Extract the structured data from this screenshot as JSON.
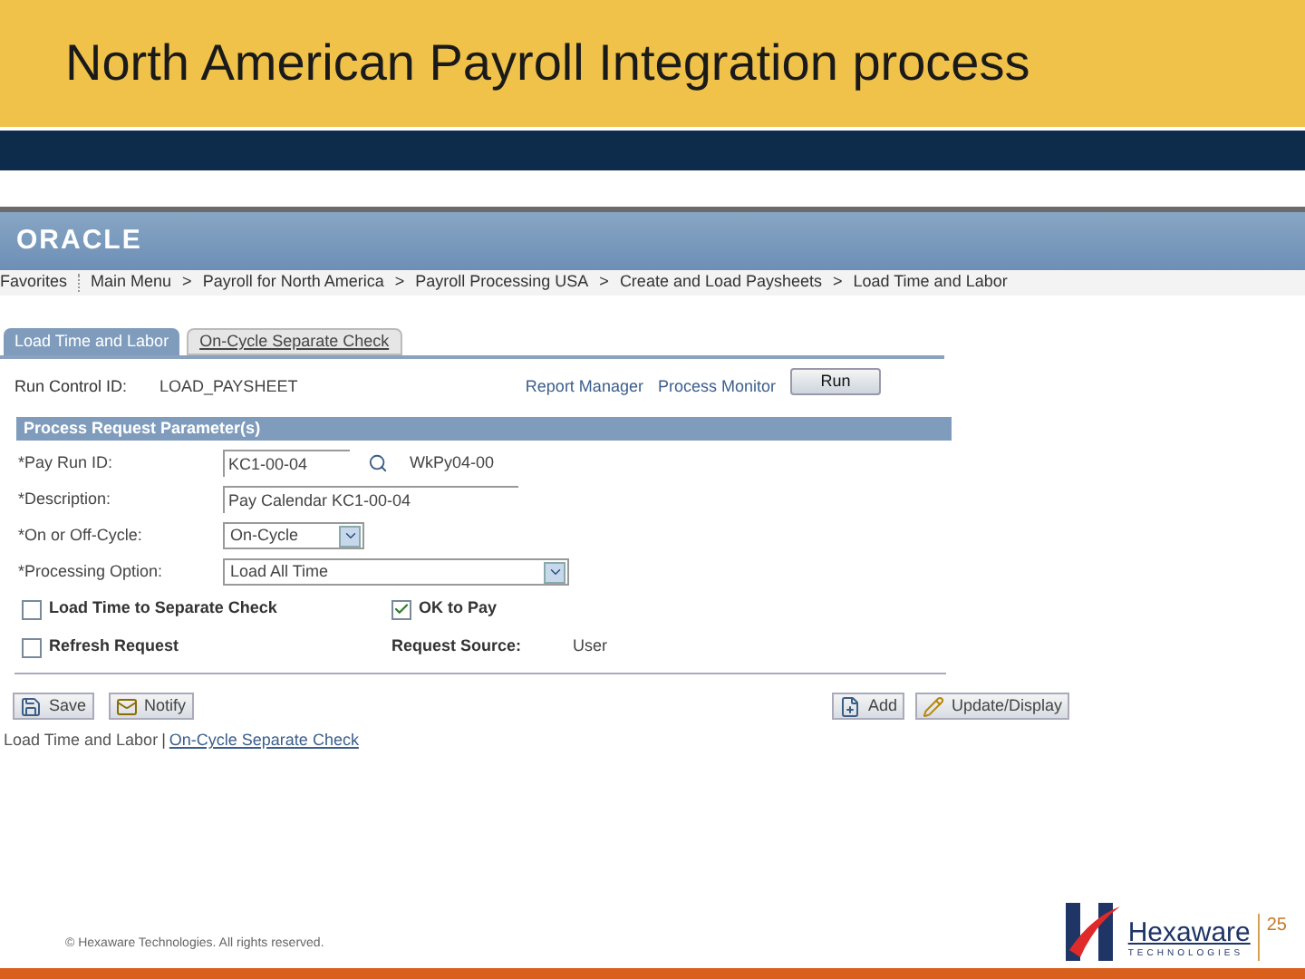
{
  "slide_title": "North American Payroll Integration process",
  "app": {
    "logo": "ORACLE",
    "breadcrumbs": [
      {
        "label": "Favorites"
      },
      {
        "label": "Main Menu"
      },
      {
        "label": "Payroll for North America",
        "separator": ">"
      },
      {
        "label": "Payroll Processing USA",
        "separator": ">"
      },
      {
        "label": "Create and Load Paysheets",
        "separator": ">"
      },
      {
        "label": "Load Time and Labor",
        "separator": ">"
      }
    ],
    "tabs": [
      {
        "label": "Load Time and Labor",
        "selected": true
      },
      {
        "label": "On-Cycle Separate Check",
        "selected": false
      }
    ],
    "run_control": {
      "label": "Run Control ID:",
      "value": "LOAD_PAYSHEET",
      "links": [
        "Report Manager",
        "Process Monitor"
      ],
      "run_button": "Run"
    },
    "section_title": "Process Request Parameter(s)",
    "fields": [
      {
        "kind": "lookup",
        "label": "*Pay Run ID:",
        "value": "KC1-00-04",
        "note": "WkPy04-00"
      },
      {
        "kind": "text",
        "label": "*Description:",
        "value": "Pay Calendar KC1-00-04"
      },
      {
        "kind": "select",
        "label": "*On or Off-Cycle:",
        "value": "On-Cycle"
      },
      {
        "kind": "select_wide",
        "label": "*Processing Option:",
        "value": "Load All Time"
      }
    ],
    "checks": [
      {
        "label": "Load Time to Separate Check",
        "checked": false
      },
      {
        "label": "OK to Pay",
        "checked": true
      },
      {
        "label": "Refresh Request",
        "checked": false
      }
    ],
    "request_source": {
      "label": "Request Source:",
      "value": "User"
    },
    "left_buttons": [
      "Save",
      "Notify"
    ],
    "right_buttons": [
      "Add",
      "Update/Display"
    ],
    "footer_links": [
      {
        "label": "Load Time and Labor",
        "selected": true
      },
      {
        "label": "On-Cycle Separate Check",
        "selected": false,
        "separator": "|"
      }
    ]
  },
  "footer": {
    "copyright": "© Hexaware Technologies. All rights reserved.",
    "brand": "Hexaware",
    "tagline": "TECHNOLOGIES",
    "page": "25"
  }
}
